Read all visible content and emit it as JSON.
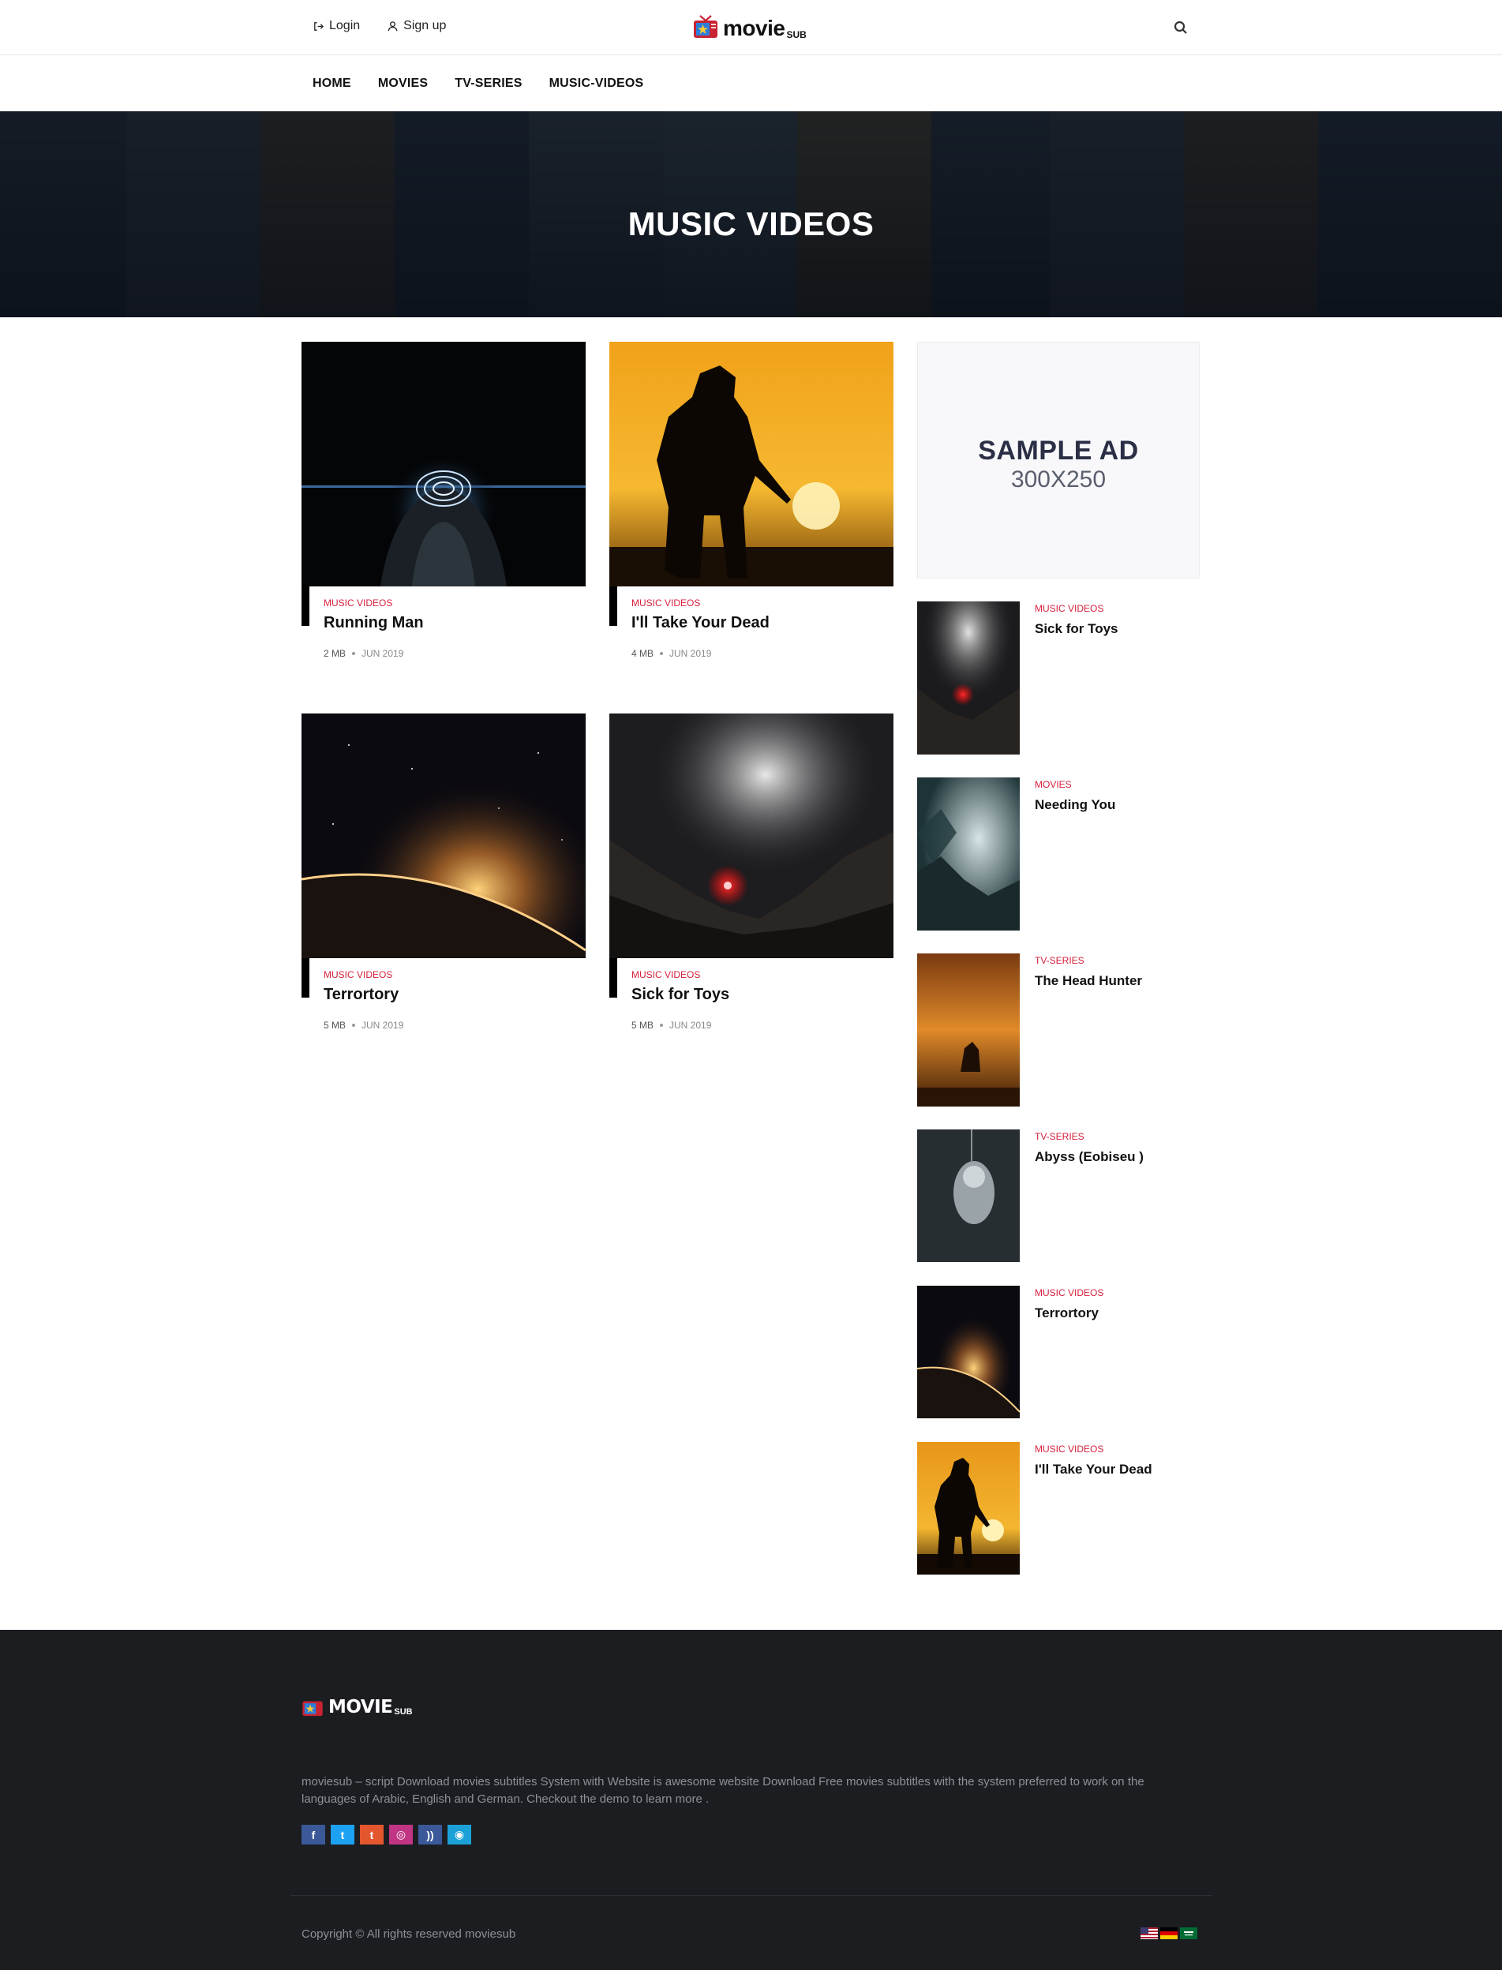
{
  "header": {
    "login_label": "Login",
    "signup_label": "Sign up",
    "logo_text": "movie",
    "logo_sub": "SUB",
    "search_icon": "search-icon"
  },
  "nav": {
    "items": [
      {
        "label": "HOME"
      },
      {
        "label": "MOVIES"
      },
      {
        "label": "TV-SERIES"
      },
      {
        "label": "MUSIC-VIDEOS"
      }
    ]
  },
  "hero": {
    "title": "MUSIC VIDEOS"
  },
  "cards": [
    {
      "category": "MUSIC VIDEOS",
      "title": "Running Man",
      "size": "2 MB",
      "date": "JUN 2019"
    },
    {
      "category": "MUSIC VIDEOS",
      "title": "I'll Take Your Dead",
      "size": "4 MB",
      "date": "JUN 2019"
    },
    {
      "category": "MUSIC VIDEOS",
      "title": "Terrortory",
      "size": "5 MB",
      "date": "JUN 2019"
    },
    {
      "category": "MUSIC VIDEOS",
      "title": "Sick for Toys",
      "size": "5 MB",
      "date": "JUN 2019"
    }
  ],
  "ad": {
    "line1": "SAMPLE AD",
    "line2": "300X250"
  },
  "sidebar": {
    "items": [
      {
        "category": "MUSIC VIDEOS",
        "title": "Sick for Toys"
      },
      {
        "category": "MOVIES",
        "title": "Needing You"
      },
      {
        "category": "TV-SERIES",
        "title": "The Head Hunter"
      },
      {
        "category": "TV-SERIES",
        "title": "Abyss (Eobiseu )"
      },
      {
        "category": "MUSIC VIDEOS",
        "title": "Terrortory"
      },
      {
        "category": "MUSIC VIDEOS",
        "title": "I'll Take Your Dead"
      }
    ]
  },
  "footer": {
    "logo_text": "MOVIE",
    "logo_sub": "SUB",
    "description": "moviesub – script Download movies subtitles System with Website is awesome website Download Free movies subtitles with the system preferred to work on the languages of Arabic, English and German. Checkout the demo to learn more .",
    "social": [
      {
        "icon": "facebook-icon",
        "glyph": "f",
        "color": "#3b5998"
      },
      {
        "icon": "twitter-icon",
        "glyph": "t",
        "color": "#1da1f2"
      },
      {
        "icon": "tumblr-icon",
        "glyph": "t",
        "color": "#e4572e"
      },
      {
        "icon": "instagram-icon",
        "glyph": "◎",
        "color": "#c13584"
      },
      {
        "icon": "rss-icon",
        "glyph": "))",
        "color": "#3b5998"
      },
      {
        "icon": "other-social-icon",
        "glyph": "◉",
        "color": "#1ba1d8"
      }
    ],
    "copyright": "Copyright © All rights reserved moviesub",
    "flags": [
      "us-flag-icon",
      "germany-flag-icon",
      "saudi-flag-icon"
    ]
  },
  "colors": {
    "accent": "#d61f3c",
    "footer_bg": "#1c1d21",
    "hero_bg": "#131a23"
  }
}
